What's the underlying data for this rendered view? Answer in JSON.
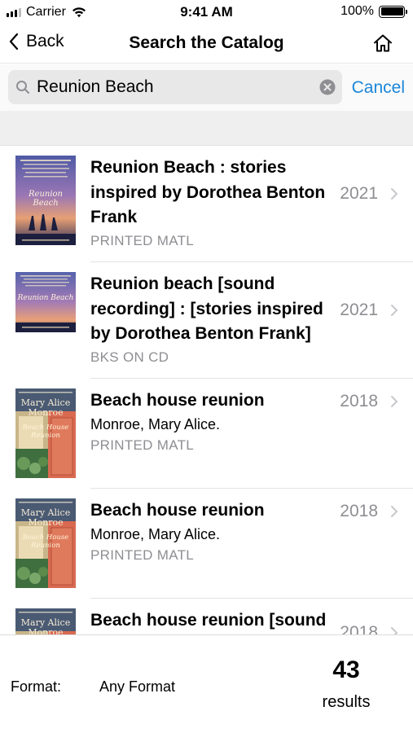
{
  "status_bar": {
    "carrier": "Carrier",
    "time": "9:41 AM",
    "battery": "100%"
  },
  "nav": {
    "back_label": "Back",
    "title": "Search the Catalog",
    "home_icon": "home-icon"
  },
  "search": {
    "query": "Reunion Beach",
    "cancel_label": "Cancel"
  },
  "results": [
    {
      "title_lines": [
        "Reunion Beach : stories",
        "inspired by Dorothea Benton",
        "Frank"
      ],
      "author": "",
      "year": "2021",
      "format": "PRINTED MATL",
      "cover_label": "Reunion Beach"
    },
    {
      "title_lines": [
        "Reunion beach [sound",
        "recording] : [stories inspired",
        "by Dorothea Benton Frank]"
      ],
      "author": "",
      "year": "2021",
      "format": "BKS ON CD",
      "cover_label": "Reunion Beach"
    },
    {
      "title_lines": [
        "Beach house reunion"
      ],
      "author": "Monroe, Mary Alice.",
      "year": "2018",
      "format": "PRINTED MATL",
      "cover_label": "Mary Alice Monroe Beach House Reunion"
    },
    {
      "title_lines": [
        "Beach house reunion"
      ],
      "author": "Monroe, Mary Alice.",
      "year": "2018",
      "format": "PRINTED MATL",
      "cover_label": "Mary Alice Monroe Beach House Reunion"
    },
    {
      "title_lines": [
        "Beach house reunion [sound"
      ],
      "author": "",
      "year": "2018",
      "format": "",
      "cover_label": "Mary Alice Monroe"
    }
  ],
  "footer": {
    "format_label": "Format:",
    "format_value": "Any Format",
    "count": "43",
    "count_label": "results"
  },
  "colors": {
    "accent": "#1a86d9",
    "secondary_text": "#8e8e93"
  }
}
